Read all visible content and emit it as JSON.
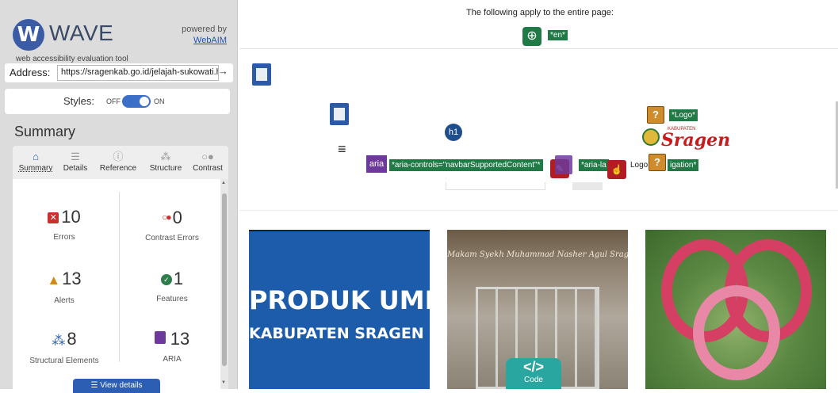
{
  "sidebar": {
    "logo_letter": "W",
    "logo_name": "WAVE",
    "tagline": "web accessibility evaluation tool",
    "powered_by": "powered by",
    "powered_link": "WebAIM",
    "address_label": "Address:",
    "address_value": "https://sragenkab.go.id/jelajah-sukowati.htr",
    "styles_label": "Styles:",
    "styles_off": "OFF",
    "styles_on": "ON",
    "summary_title": "Summary",
    "tabs": [
      {
        "label": "Summary",
        "icon": "home-icon",
        "active": true
      },
      {
        "label": "Details",
        "icon": "list-icon",
        "active": false
      },
      {
        "label": "Reference",
        "icon": "info-icon",
        "active": false
      },
      {
        "label": "Structure",
        "icon": "structure-icon",
        "active": false
      },
      {
        "label": "Contrast",
        "icon": "contrast-icon",
        "active": false
      }
    ],
    "stats": {
      "errors": {
        "value": "10",
        "label": "Errors"
      },
      "contrast_errors": {
        "value": "0",
        "label": "Contrast Errors"
      },
      "alerts": {
        "value": "13",
        "label": "Alerts"
      },
      "features": {
        "value": "1",
        "label": "Features"
      },
      "structural": {
        "value": "8",
        "label": "Structural Elements"
      },
      "aria": {
        "value": "13",
        "label": "ARIA"
      }
    },
    "view_details": "View details"
  },
  "page": {
    "topnote": "The following apply to the entire page:",
    "lang_tag": "*en*",
    "aria_badge": "aria",
    "aria_controls_tag": "*aria-controls=\"navbarSupportedContent\"*",
    "aria_label_tag": "*aria-la",
    "logo_tag": "*Logo*",
    "navigation_tag": "Logo",
    "navigation_tag_2": "igation*",
    "h1_badge": "h1",
    "hamburger": "≡",
    "brand_kabupaten": "KABUPATEN",
    "brand_name": "Sragen",
    "code_label": "Code",
    "code_glyph": "</>"
  },
  "cards": {
    "umkm_line1": "PRODUK UMKM",
    "umkm_line2": "KABUPATEN SRAGEN",
    "gate_sign": "Makam Syekh Muhammad Nasher Agul Sragenwdo"
  },
  "colors": {
    "accent_blue": "#2c5fb4",
    "error_red": "#c9302c",
    "alert_orange": "#d28a16",
    "feature_green": "#2e7d4a",
    "aria_purple": "#6d3a9c",
    "wave_green_tag": "#1f7a46"
  }
}
